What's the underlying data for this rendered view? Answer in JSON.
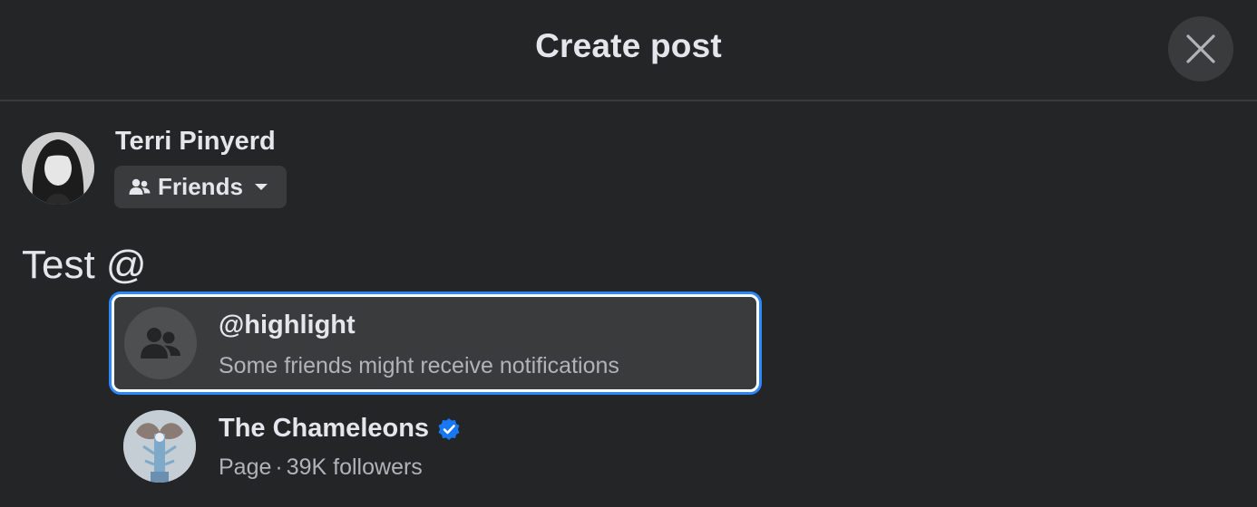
{
  "dialog": {
    "title": "Create post",
    "close_icon": "close-icon"
  },
  "author": {
    "name": "Terri Pinyerd",
    "audience": {
      "label": "Friends",
      "icon": "people-icon",
      "caret_icon": "caret-down-icon"
    }
  },
  "composer": {
    "text": "Test @"
  },
  "mention_suggestions": [
    {
      "title": "@highlight",
      "subtitle": "Some friends might receive notifications",
      "icon": "group-icon",
      "selected": true
    },
    {
      "title": "The Chameleons",
      "verified": true,
      "type": "Page",
      "followers": "39K followers",
      "icon": "page-avatar"
    }
  ],
  "colors": {
    "background": "#242526",
    "surface": "#3a3b3c",
    "text_primary": "#e4e6eb",
    "text_secondary": "#b0b3b8",
    "focus_ring": "#2d88ff",
    "verified_blue": "#1877f2"
  }
}
